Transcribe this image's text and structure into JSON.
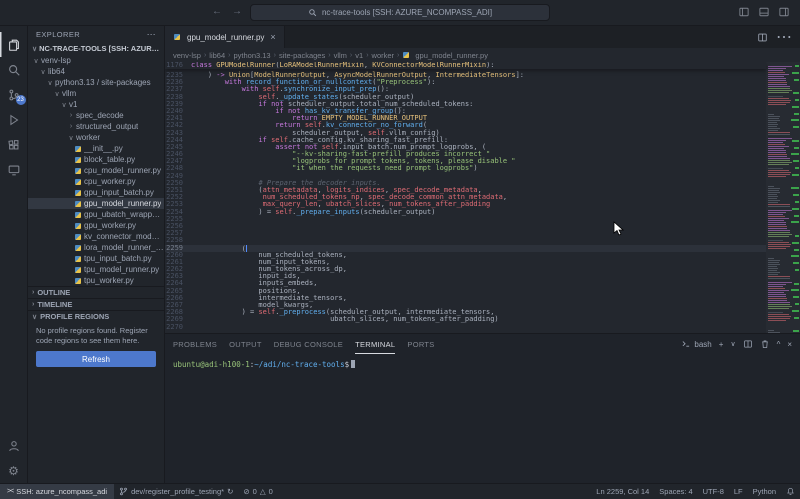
{
  "titlebar": {
    "title": "nc-trace-tools [SSH: AZURE_NCOMPASS_ADI]"
  },
  "activity_bar": {
    "scm_badge": "23"
  },
  "sidebar": {
    "header": "EXPLORER",
    "section": "NC-TRACE-TOOLS [SSH: AZURE_NCOMPASS_ADI]",
    "tree": [
      {
        "label": "venv-lsp",
        "indent": 0,
        "kind": "open"
      },
      {
        "label": "lib64",
        "indent": 1,
        "kind": "open"
      },
      {
        "label": "python3.13 / site-packages",
        "indent": 2,
        "kind": "open"
      },
      {
        "label": "vllm",
        "indent": 3,
        "kind": "open"
      },
      {
        "label": "v1",
        "indent": 4,
        "kind": "open"
      },
      {
        "label": "spec_decode",
        "indent": 5,
        "kind": "closed"
      },
      {
        "label": "structured_output",
        "indent": 5,
        "kind": "closed"
      },
      {
        "label": "worker",
        "indent": 5,
        "kind": "open"
      },
      {
        "label": "__init__.py",
        "indent": 6,
        "kind": "py"
      },
      {
        "label": "block_table.py",
        "indent": 6,
        "kind": "py"
      },
      {
        "label": "cpu_model_runner.py",
        "indent": 6,
        "kind": "py"
      },
      {
        "label": "cpu_worker.py",
        "indent": 6,
        "kind": "py"
      },
      {
        "label": "gpu_input_batch.py",
        "indent": 6,
        "kind": "py"
      },
      {
        "label": "gpu_model_runner.py",
        "indent": 6,
        "kind": "py",
        "selected": true
      },
      {
        "label": "gpu_ubatch_wrapper.py",
        "indent": 6,
        "kind": "py"
      },
      {
        "label": "gpu_worker.py",
        "indent": 6,
        "kind": "py"
      },
      {
        "label": "kv_connector_model_runner_mixin.py",
        "indent": 6,
        "kind": "py"
      },
      {
        "label": "lora_model_runner_mixin.py",
        "indent": 6,
        "kind": "py"
      },
      {
        "label": "tpu_input_batch.py",
        "indent": 6,
        "kind": "py"
      },
      {
        "label": "tpu_model_runner.py",
        "indent": 6,
        "kind": "py"
      },
      {
        "label": "tpu_worker.py",
        "indent": 6,
        "kind": "py"
      }
    ],
    "outline_label": "OUTLINE",
    "timeline_label": "TIMELINE",
    "profile_regions": {
      "title": "PROFILE REGIONS",
      "message": "No profile regions found. Register code regions to see them here.",
      "button": "Refresh"
    }
  },
  "editor": {
    "tab": {
      "label": "gpu_model_runner.py"
    },
    "breadcrumbs": [
      "venv-lsp",
      "lib64",
      "python3.13",
      "site-packages",
      "vllm",
      "v1",
      "worker",
      "gpu_model_runner.py"
    ],
    "sticky": {
      "n": 1176,
      "t": [
        [
          "k",
          "class "
        ],
        [
          "c",
          "GPUModelRunner"
        ],
        [
          "t",
          "("
        ],
        [
          "c",
          "LoRAModelRunnerMixin"
        ],
        [
          "t",
          ", "
        ],
        [
          "c",
          "KVConnectorModelRunnerMixin"
        ],
        [
          "t",
          "):"
        ]
      ]
    },
    "lines": [
      {
        "n": 2235,
        "t": [
          [
            "t",
            "    ) "
          ],
          [
            "k",
            "->"
          ],
          [
            "t",
            " "
          ],
          [
            "c",
            "Union"
          ],
          [
            "t",
            "["
          ],
          [
            "c",
            "ModelRunnerOutput"
          ],
          [
            "t",
            ", "
          ],
          [
            "c",
            "AsyncModelRunnerOutput"
          ],
          [
            "t",
            ", "
          ],
          [
            "c",
            "IntermediateTensors"
          ],
          [
            "t",
            "]:"
          ]
        ]
      },
      {
        "n": 2236,
        "t": [
          [
            "t",
            "        "
          ],
          [
            "k",
            "with"
          ],
          [
            "t",
            " "
          ],
          [
            "f",
            "record_function_or_nullcontext"
          ],
          [
            "t",
            "("
          ],
          [
            "s",
            "\"Preprocess\""
          ],
          [
            "t",
            "):"
          ]
        ]
      },
      {
        "n": 2237,
        "t": [
          [
            "t",
            "            "
          ],
          [
            "k",
            "with"
          ],
          [
            "t",
            " "
          ],
          [
            "v",
            "self"
          ],
          [
            "t",
            "."
          ],
          [
            "f",
            "synchronize_input_prep"
          ],
          [
            "t",
            "():"
          ]
        ]
      },
      {
        "n": 2238,
        "t": [
          [
            "t",
            "                "
          ],
          [
            "v",
            "self"
          ],
          [
            "t",
            "."
          ],
          [
            "f",
            "_update_states"
          ],
          [
            "t",
            "(scheduler_output)"
          ]
        ]
      },
      {
        "n": 2239,
        "t": [
          [
            "t",
            "                "
          ],
          [
            "k",
            "if"
          ],
          [
            "t",
            " "
          ],
          [
            "k",
            "not"
          ],
          [
            "t",
            " scheduler_output.total_num_scheduled_tokens:"
          ]
        ]
      },
      {
        "n": 2240,
        "t": [
          [
            "t",
            "                    "
          ],
          [
            "k",
            "if"
          ],
          [
            "t",
            " "
          ],
          [
            "k",
            "not"
          ],
          [
            "t",
            " "
          ],
          [
            "f",
            "has_kv_transfer_group"
          ],
          [
            "t",
            "():"
          ]
        ]
      },
      {
        "n": 2241,
        "t": [
          [
            "t",
            "                        "
          ],
          [
            "k",
            "return"
          ],
          [
            "t",
            " "
          ],
          [
            "c",
            "EMPTY_MODEL_RUNNER_OUTPUT"
          ]
        ]
      },
      {
        "n": 2242,
        "t": [
          [
            "t",
            "                    "
          ],
          [
            "k",
            "return"
          ],
          [
            "t",
            " "
          ],
          [
            "v",
            "self"
          ],
          [
            "t",
            "."
          ],
          [
            "f",
            "kv_connector_no_forward"
          ],
          [
            "t",
            "("
          ]
        ]
      },
      {
        "n": 2243,
        "t": [
          [
            "t",
            "                        scheduler_output, "
          ],
          [
            "v",
            "self"
          ],
          [
            "t",
            ".vllm_config)"
          ]
        ]
      },
      {
        "n": 2244,
        "t": [
          [
            "t",
            "                "
          ],
          [
            "k",
            "if"
          ],
          [
            "t",
            " "
          ],
          [
            "v",
            "self"
          ],
          [
            "t",
            ".cache_config.kv_sharing_fast_prefill:"
          ]
        ]
      },
      {
        "n": 2245,
        "t": [
          [
            "t",
            "                    "
          ],
          [
            "k",
            "assert"
          ],
          [
            "t",
            " "
          ],
          [
            "k",
            "not"
          ],
          [
            "t",
            " "
          ],
          [
            "v",
            "self"
          ],
          [
            "t",
            ".input_batch.num_prompt_logprobs, ("
          ]
        ]
      },
      {
        "n": 2246,
        "t": [
          [
            "t",
            "                        "
          ],
          [
            "s",
            "\"--kv-sharing-fast-prefill produces incorrect \""
          ]
        ]
      },
      {
        "n": 2247,
        "t": [
          [
            "t",
            "                        "
          ],
          [
            "s",
            "\"logprobs for prompt tokens, tokens, please disable \""
          ]
        ]
      },
      {
        "n": 2248,
        "t": [
          [
            "t",
            "                        "
          ],
          [
            "s",
            "\"it when the requests need prompt logprobs\""
          ],
          [
            "t",
            ")"
          ]
        ]
      },
      {
        "n": 2249,
        "t": []
      },
      {
        "n": 2250,
        "t": [
          [
            "t",
            "                "
          ],
          [
            "m",
            "# Prepare the decoder inputs."
          ]
        ]
      },
      {
        "n": 2251,
        "t": [
          [
            "t",
            "                ("
          ],
          [
            "v",
            "attn_metadata"
          ],
          [
            "t",
            ", "
          ],
          [
            "v",
            "logits_indices"
          ],
          [
            "t",
            ", "
          ],
          [
            "v",
            "spec_decode_metadata"
          ],
          [
            "t",
            ","
          ]
        ]
      },
      {
        "n": 2252,
        "t": [
          [
            "t",
            "                 "
          ],
          [
            "v",
            "num_scheduled_tokens_np"
          ],
          [
            "t",
            ", "
          ],
          [
            "v",
            "spec_decode_common_attn_metadata"
          ],
          [
            "t",
            ","
          ]
        ]
      },
      {
        "n": 2253,
        "t": [
          [
            "t",
            "                 "
          ],
          [
            "v",
            "max_query_len"
          ],
          [
            "t",
            ", "
          ],
          [
            "v",
            "ubatch_slices"
          ],
          [
            "t",
            ", "
          ],
          [
            "v",
            "num_tokens_after_padding"
          ]
        ]
      },
      {
        "n": 2254,
        "t": [
          [
            "t",
            "                ) = "
          ],
          [
            "v",
            "self"
          ],
          [
            "t",
            "."
          ],
          [
            "f",
            "_prepare_inputs"
          ],
          [
            "t",
            "(scheduler_output)"
          ]
        ]
      },
      {
        "n": 2255,
        "t": []
      },
      {
        "n": 2256,
        "t": []
      },
      {
        "n": 2257,
        "t": []
      },
      {
        "n": 2258,
        "t": []
      },
      {
        "n": 2259,
        "cur": true,
        "t": [
          [
            "t",
            "            ("
          ]
        ]
      },
      {
        "n": 2260,
        "t": [
          [
            "t",
            "                num_scheduled_tokens,"
          ]
        ]
      },
      {
        "n": 2261,
        "t": [
          [
            "t",
            "                num_input_tokens,"
          ]
        ]
      },
      {
        "n": 2262,
        "t": [
          [
            "t",
            "                num_tokens_across_dp,"
          ]
        ]
      },
      {
        "n": 2263,
        "t": [
          [
            "t",
            "                input_ids,"
          ]
        ]
      },
      {
        "n": 2264,
        "t": [
          [
            "t",
            "                inputs_embeds,"
          ]
        ]
      },
      {
        "n": 2265,
        "t": [
          [
            "t",
            "                positions,"
          ]
        ]
      },
      {
        "n": 2266,
        "t": [
          [
            "t",
            "                intermediate_tensors,"
          ]
        ]
      },
      {
        "n": 2267,
        "t": [
          [
            "t",
            "                model_kwargs,"
          ]
        ]
      },
      {
        "n": 2268,
        "t": [
          [
            "t",
            "            ) = "
          ],
          [
            "v",
            "self"
          ],
          [
            "t",
            "."
          ],
          [
            "f",
            "_preprocess"
          ],
          [
            "t",
            "(scheduler_output, intermediate_tensors,"
          ]
        ]
      },
      {
        "n": 2269,
        "t": [
          [
            "t",
            "                                 ubatch_slices, num_tokens_after_padding)"
          ]
        ]
      },
      {
        "n": 2270,
        "t": []
      }
    ]
  },
  "panel": {
    "tabs": [
      "PROBLEMS",
      "OUTPUT",
      "DEBUG CONSOLE",
      "TERMINAL",
      "PORTS"
    ],
    "active_tab": "TERMINAL",
    "shell": "bash",
    "terminal": {
      "user": "ubuntu@adi-h100-1",
      "separator": ":",
      "path": "~/adi/nc-trace-tools",
      "symbol": "$"
    }
  },
  "status_bar": {
    "remote": "SSH: azure_ncompass_adi",
    "branch": "dev/register_profile_testing*",
    "errors": "0",
    "warnings": "0",
    "cursor_position": "Ln 2259, Col 14",
    "indent": "Spaces: 4",
    "encoding": "UTF-8",
    "eol": "LF",
    "language": "Python"
  },
  "colors": {
    "accent_blue": "#4d78cc",
    "badge_blue": "#4d78cc",
    "added_marker_green": "#3fb950",
    "keyword_purple": "#c678dd",
    "class_yellow": "#e5c07b",
    "function_blue": "#61afef",
    "string_green": "#98c379",
    "variable_red": "#e06c75",
    "terminal_user_green": "#98c379",
    "terminal_path_blue": "#61afef"
  }
}
